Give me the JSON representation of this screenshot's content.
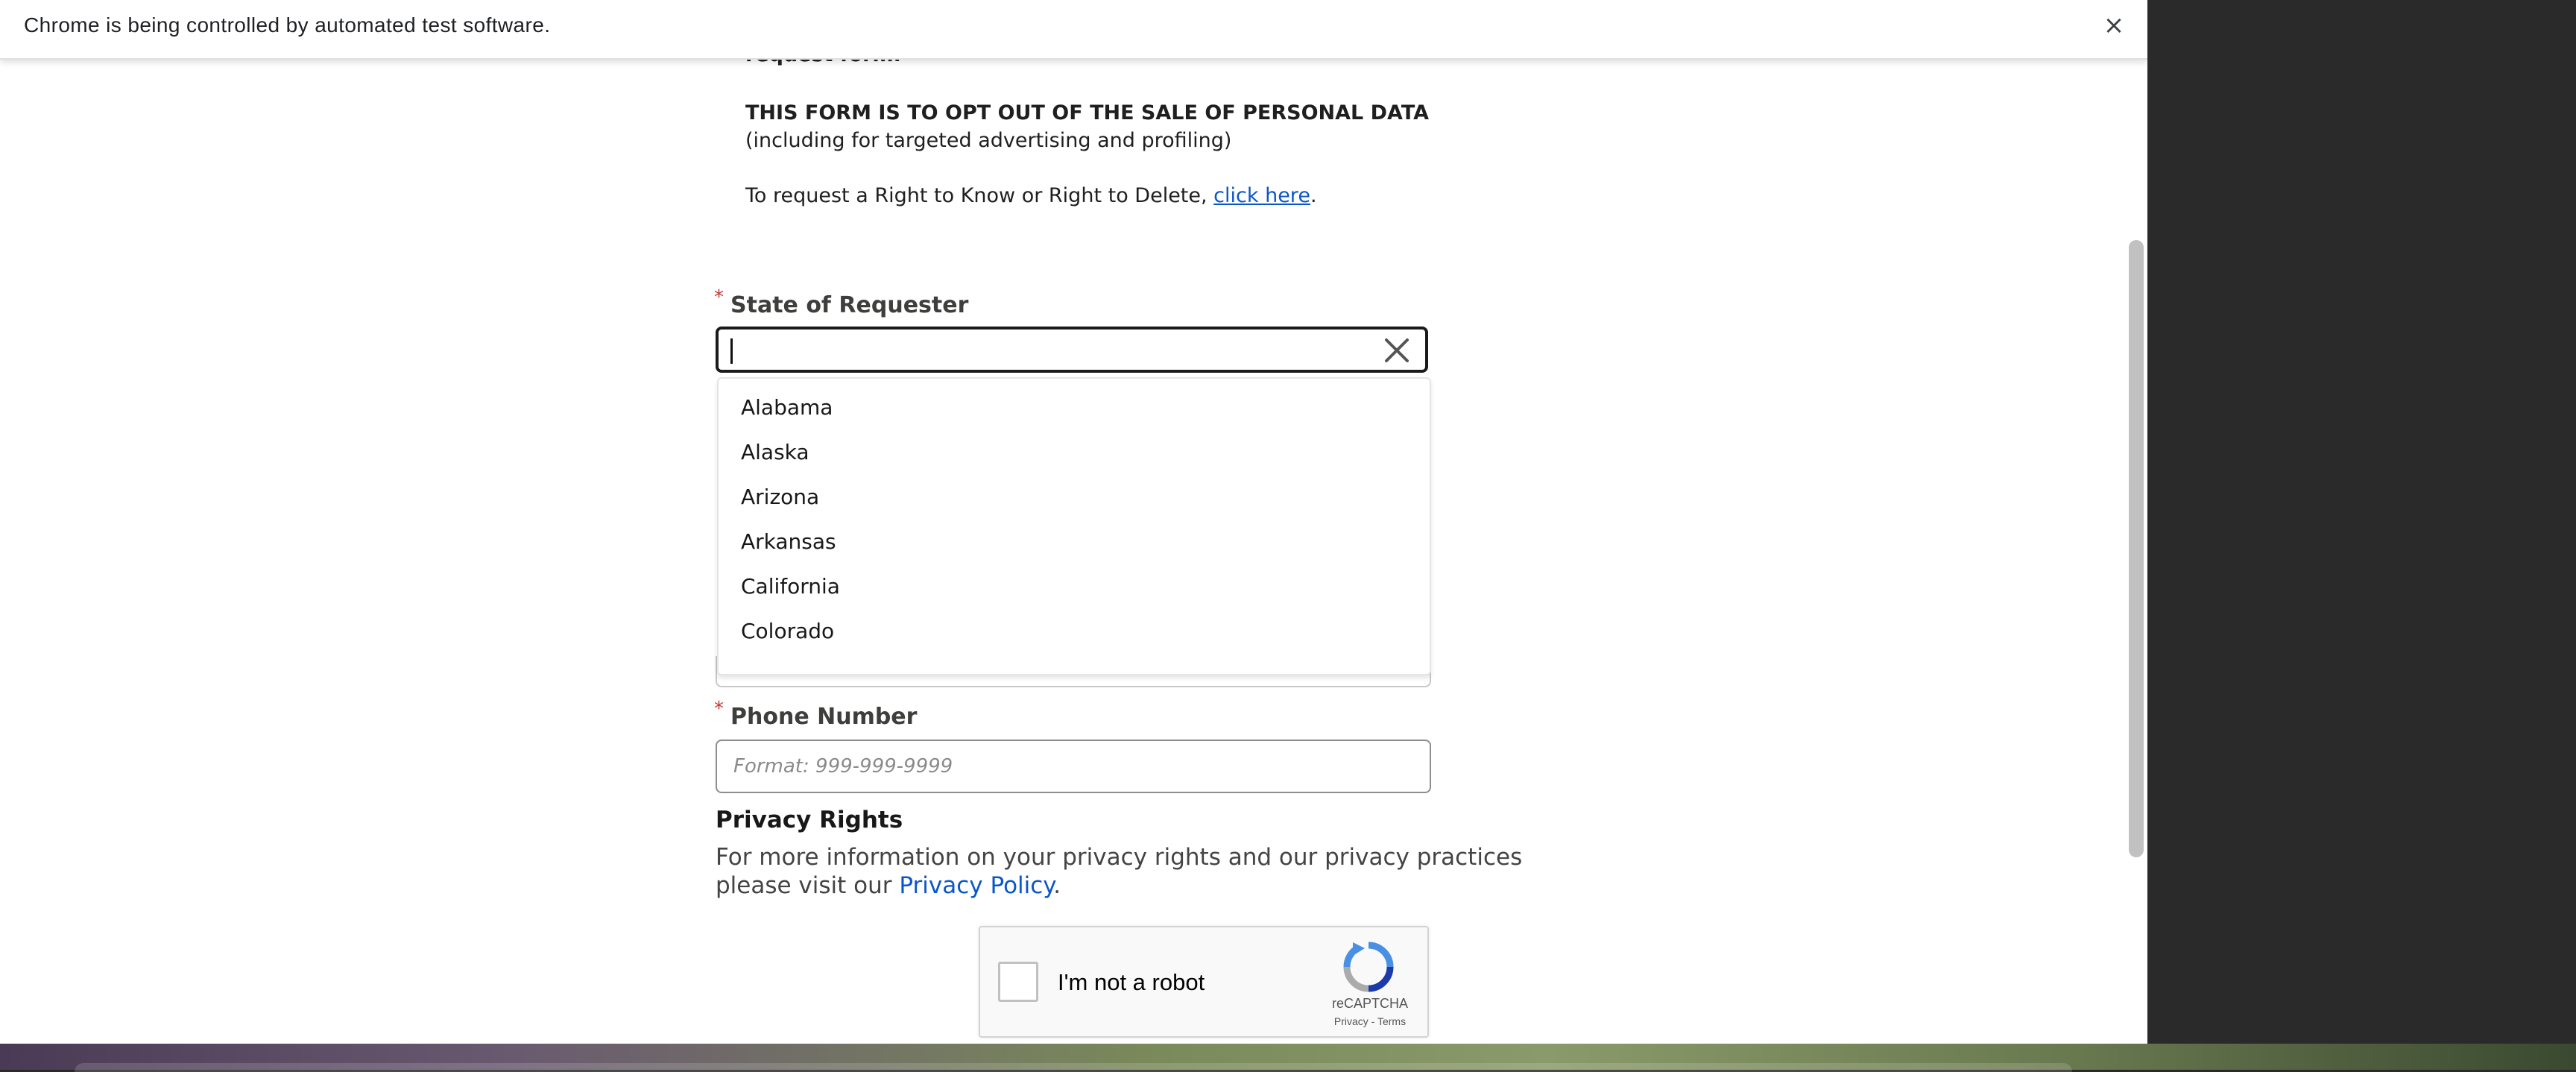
{
  "infobar": {
    "message": "Chrome is being controlled by automated test software.",
    "close_glyph": "×"
  },
  "intro": {
    "partial_line": "request form.",
    "optout_heading": "THIS FORM IS TO OPT OUT OF THE SALE OF PERSONAL DATA",
    "optout_sub": "(including for targeted advertising and profiling)",
    "request_prefix": "To request a Right to Know or Right to Delete, ",
    "request_link": "click here",
    "request_suffix": "."
  },
  "state_field": {
    "required_marker": "*",
    "label": "State of Requester",
    "value": "",
    "clear_icon": "close-icon",
    "options": [
      "Alabama",
      "Alaska",
      "Arizona",
      "Arkansas",
      "California",
      "Colorado"
    ]
  },
  "phone_field": {
    "required_marker": "*",
    "label": "Phone Number",
    "placeholder": "Format: 999-999-9999"
  },
  "privacy": {
    "title": "Privacy Rights",
    "line1": "For more information on your privacy rights and our privacy practices",
    "line2_prefix": "please visit our ",
    "link": "Privacy Policy",
    "line2_suffix": "."
  },
  "captcha": {
    "label": "I'm not a robot",
    "brand": "reCAPTCHA",
    "privacy_link": "Privacy",
    "separator": " - ",
    "terms_link": "Terms",
    "logo_icon": "recaptcha-logo-icon"
  },
  "colors": {
    "link": "#0b57c8",
    "required": "#c23934",
    "focus_border": "#1a1a1a"
  }
}
